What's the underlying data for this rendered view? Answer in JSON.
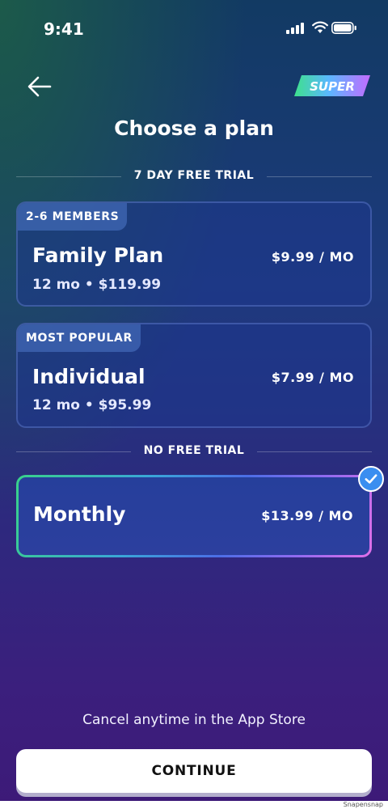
{
  "status_bar": {
    "time": "9:41"
  },
  "header": {
    "title": "Choose a plan",
    "logo_text": "SUPER"
  },
  "sections": {
    "trial_label": "7 DAY FREE TRIAL",
    "no_trial_label": "NO FREE TRIAL"
  },
  "plans": [
    {
      "badge": "2-6 MEMBERS",
      "name": "Family Plan",
      "sub": "12 mo • $119.99",
      "price": "$9.99 / MO"
    },
    {
      "badge": "MOST POPULAR",
      "name": "Individual",
      "sub": "12 mo • $95.99",
      "price": "$7.99 / MO"
    },
    {
      "name": "Monthly",
      "price": "$13.99 / MO",
      "selected": true
    }
  ],
  "footer": {
    "cancel_text": "Cancel anytime in the App Store",
    "continue_label": "CONTINUE",
    "watermark": "Snapensnap"
  },
  "colors": {
    "accent_check": "#3a8ef0",
    "logo_gradient": [
      "#3ee08c",
      "#5ab8ff",
      "#c36bff"
    ]
  }
}
